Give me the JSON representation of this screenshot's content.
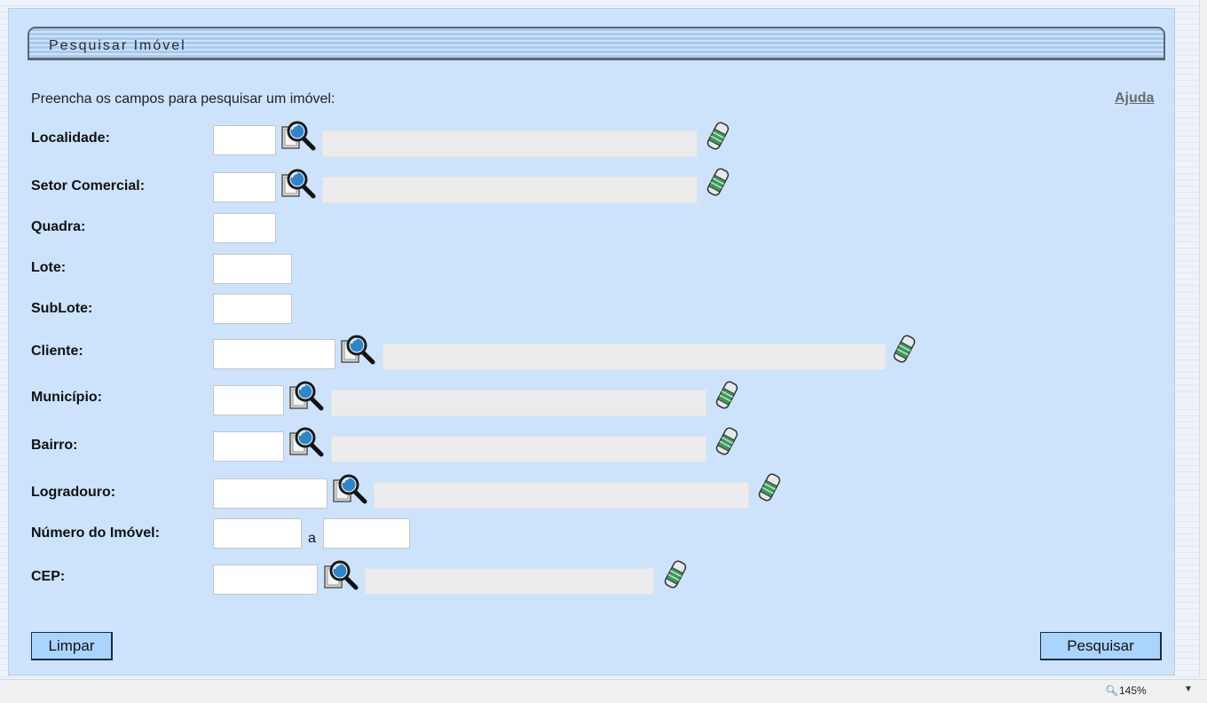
{
  "panel": {
    "title": "Pesquisar Imóvel",
    "instruction": "Preencha os campos para pesquisar um imóvel:",
    "help_link": "Ajuda"
  },
  "fields": {
    "localidade": {
      "label": "Localidade:",
      "value": ""
    },
    "setor_comercial": {
      "label": "Setor Comercial:",
      "value": ""
    },
    "quadra": {
      "label": "Quadra:",
      "value": ""
    },
    "lote": {
      "label": "Lote:",
      "value": ""
    },
    "sublote": {
      "label": "SubLote:",
      "value": ""
    },
    "cliente": {
      "label": "Cliente:",
      "value": ""
    },
    "municipio": {
      "label": "Município:",
      "value": ""
    },
    "bairro": {
      "label": "Bairro:",
      "value": ""
    },
    "logradouro": {
      "label": "Logradouro:",
      "value": ""
    },
    "numero_imovel": {
      "label": "Número do Imóvel:",
      "separator": "a",
      "value_from": "",
      "value_to": ""
    },
    "cep": {
      "label": "CEP:",
      "value": ""
    }
  },
  "buttons": {
    "clear": "Limpar",
    "search": "Pesquisar"
  },
  "statusbar": {
    "zoom": "145%"
  },
  "icons": {
    "lookup": "magnifier-document-icon",
    "clear_field": "eraser-icon"
  },
  "colors": {
    "panel_bg": "#cce3fb",
    "button_bg": "#aad4fb",
    "description_bg": "#ececec"
  }
}
